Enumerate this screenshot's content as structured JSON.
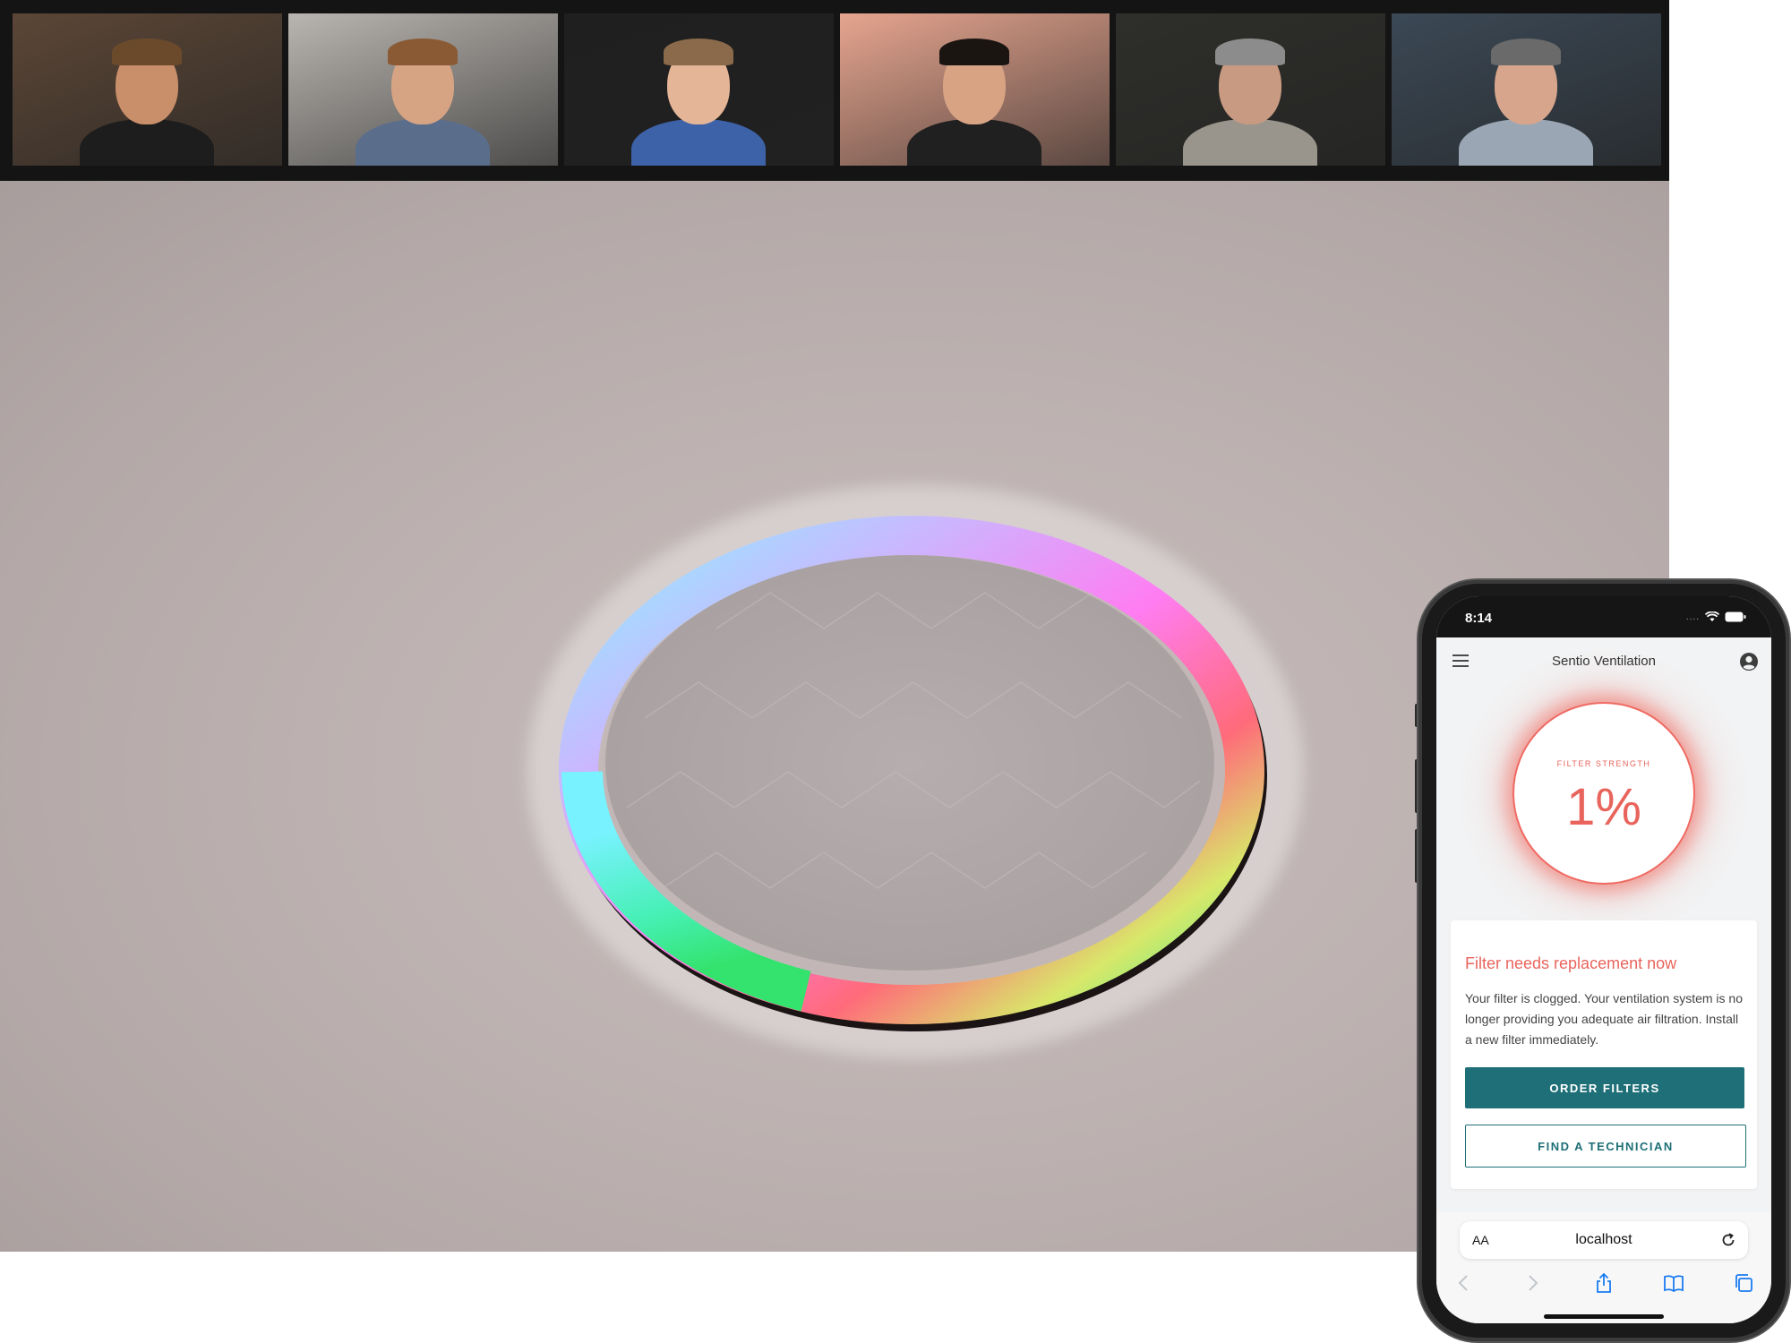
{
  "call": {
    "participants": [
      {
        "name": "participant-1",
        "bg": "#5b4636",
        "skin": "#c98e6a",
        "shirt": "#1d1d1d",
        "hair": "#6b4a2c"
      },
      {
        "name": "participant-2",
        "bg": "#b9b5b0",
        "skin": "#d6a383",
        "shirt": "#5a6e8c",
        "hair": "#8a5a34"
      },
      {
        "name": "participant-3",
        "bg": "#1f1f1f",
        "skin": "#e4b597",
        "shirt": "#3d62a8",
        "hair": "#8a6a4a"
      },
      {
        "name": "participant-4",
        "bg": "#e6a58f",
        "skin": "#d8a383",
        "shirt": "#202020",
        "hair": "#1b1512"
      },
      {
        "name": "participant-5",
        "bg": "#2e2e2a",
        "skin": "#c89a82",
        "shirt": "#9a958c",
        "hair": "#8c8c8c"
      },
      {
        "name": "participant-6",
        "bg": "#3b4855",
        "skin": "#d7a58c",
        "shirt": "#9aa6b4",
        "hair": "#6a6a6a"
      }
    ]
  },
  "phone": {
    "status": {
      "time": "8:14",
      "signal": "...."
    },
    "app": {
      "title": "Sentio Ventilation"
    },
    "gauge": {
      "label": "FILTER STRENGTH",
      "value": "1%",
      "level": 0.01
    },
    "alert": {
      "title": "Filter needs replacement now",
      "body": "Your filter is clogged. Your ventilation system is no longer providing you adequate air filtration. Install a new filter immediately.",
      "primary_button": "ORDER FILTERS",
      "secondary_button": "FIND A TECHNICIAN"
    },
    "browser": {
      "text_size": "AA",
      "url": "localhost"
    }
  },
  "colors": {
    "accent": "#1e6f77",
    "alert": "#e8645c"
  }
}
